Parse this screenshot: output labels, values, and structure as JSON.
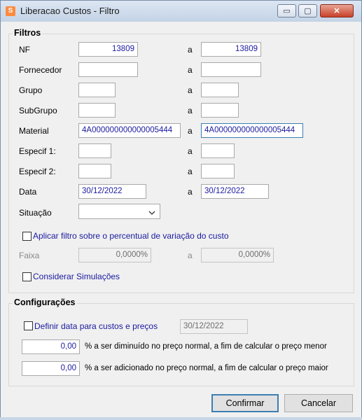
{
  "window": {
    "title": "Liberacao Custos - Filtro",
    "icon": "app-icon",
    "controls": {
      "minimize": "▭",
      "maximize": "▢",
      "close": "✕"
    }
  },
  "filtros": {
    "legend": "Filtros",
    "a_label": "a",
    "rows": {
      "nf": {
        "label": "NF",
        "from": "13809",
        "to": "13809"
      },
      "fornecedor": {
        "label": "Fornecedor",
        "from": "",
        "to": ""
      },
      "grupo": {
        "label": "Grupo",
        "from": "",
        "to": ""
      },
      "subgrupo": {
        "label": "SubGrupo",
        "from": "",
        "to": ""
      },
      "material": {
        "label": "Material",
        "from": "4A000000000000005444",
        "to": "4A000000000000005444"
      },
      "especif1": {
        "label": "Especif 1:",
        "from": "",
        "to": ""
      },
      "especif2": {
        "label": "Especif 2:",
        "from": "",
        "to": ""
      },
      "data": {
        "label": "Data",
        "from": "30/12/2022",
        "to": "30/12/2022"
      }
    },
    "situacao": {
      "label": "Situação",
      "value": ""
    },
    "aplicar_filtro": {
      "label": "Aplicar filtro sobre o percentual de variação do custo",
      "checked": false
    },
    "faixa": {
      "label": "Faixa",
      "from": "0,0000%",
      "to": "0,0000%"
    },
    "considerar": {
      "label": "Considerar Simulações",
      "checked": false
    }
  },
  "configuracoes": {
    "legend": "Configurações",
    "definir_data": {
      "label": "Definir data para custos e preços",
      "checked": false,
      "value": "30/12/2022"
    },
    "diminuido": {
      "value": "0,00",
      "label": "% a ser diminuído no preço normal, a fim de calcular o preço menor"
    },
    "adicionado": {
      "value": "0,00",
      "label": "% a ser adicionado no preço normal, a fim de calcular o preço maior"
    }
  },
  "buttons": {
    "confirmar": "Confirmar",
    "cancelar": "Cancelar"
  }
}
